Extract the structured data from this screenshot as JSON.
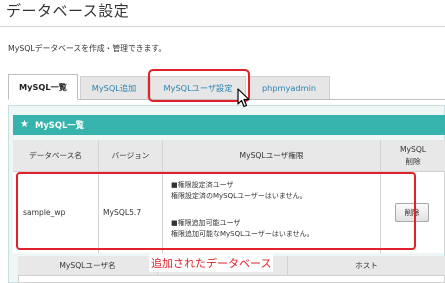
{
  "page": {
    "title": "データベース設定",
    "description": "MySQLデータベースを作成・管理できます。"
  },
  "tabs": [
    {
      "label": "MySQL一覧",
      "active": true
    },
    {
      "label": "MySQL追加",
      "active": false
    },
    {
      "label": "MySQLユーザ設定",
      "active": false
    },
    {
      "label": "phpmyadmin",
      "active": false
    }
  ],
  "panel": {
    "title": "MySQL一覧",
    "columns": [
      "データベース名",
      "バージョン",
      "MySQLユーザ権限",
      "MySQL",
      "削除"
    ],
    "rows": [
      {
        "db_name": "sample_wp",
        "version": "MySQL5.7",
        "perm_set_title": "■権限設定済ユーザ",
        "perm_set_text": "権限設定済のMySQLユーザーはいません。",
        "perm_add_title": "■権限追加可能ユーザ",
        "perm_add_text": "権限追加可能なMySQLユーザーはいません。",
        "delete_label": "削除"
      }
    ]
  },
  "sub_table": {
    "columns": [
      "MySQLユーザ名",
      "",
      "ホスト"
    ]
  },
  "annotation": "追加されたデータベース",
  "colors": {
    "accent": "#37b3ad",
    "highlight": "#e0202a",
    "link": "#2a82b0"
  }
}
